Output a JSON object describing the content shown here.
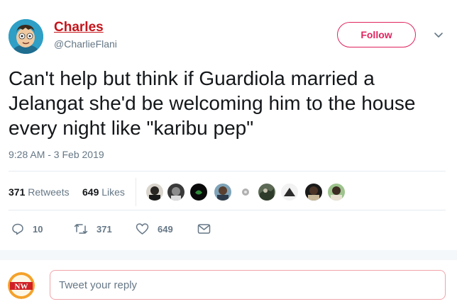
{
  "user": {
    "name": "Charles",
    "handle": "@CharlieFlani"
  },
  "follow_label": "Follow",
  "tweet": {
    "text": "Can't help but think if Guardiola married a Jelangat she'd be welcoming him to the house every night like \"karibu pep\"",
    "timestamp": "9:28 AM - 3 Feb 2019"
  },
  "stats": {
    "retweets_count": "371",
    "retweets_label": "Retweets",
    "likes_count": "649",
    "likes_label": "Likes"
  },
  "actions": {
    "replies": "10",
    "retweets": "371",
    "likes": "649"
  },
  "reply": {
    "placeholder": "Tweet your reply",
    "logo_text": "NW"
  },
  "colors": {
    "follow_accent": "#e0245e",
    "name_color": "#c5141b",
    "secondary_text": "#657786"
  }
}
